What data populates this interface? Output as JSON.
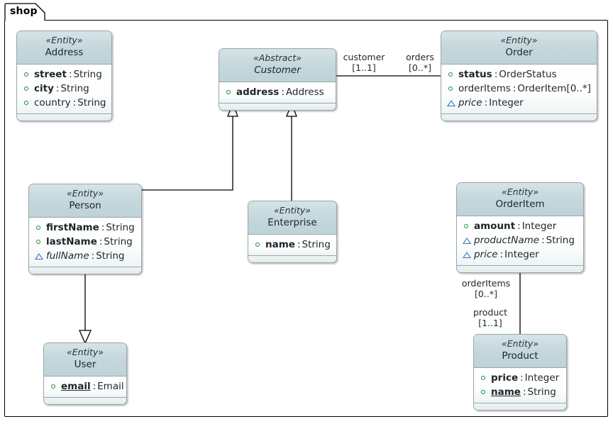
{
  "diagram": {
    "type": "uml-class-diagram",
    "package": {
      "name": "shop"
    },
    "classes": [
      {
        "id": "address",
        "stereotype": "«Entity»",
        "name": "Address",
        "abstract": false,
        "attributes": [
          {
            "icon": "circle",
            "name": "street",
            "sep": ":",
            "type": "String",
            "bold": true,
            "italic": false,
            "underline": false,
            "type_italic": false
          },
          {
            "icon": "circle",
            "name": "city",
            "sep": ":",
            "type": "String",
            "bold": true,
            "italic": false,
            "underline": false,
            "type_italic": false
          },
          {
            "icon": "circle",
            "name": "country",
            "sep": ":",
            "type": "String",
            "bold": false,
            "italic": false,
            "underline": false,
            "type_italic": false
          }
        ]
      },
      {
        "id": "customer",
        "stereotype": "«Abstract»",
        "name": "Customer",
        "abstract": true,
        "attributes": [
          {
            "icon": "circle",
            "name": "address",
            "sep": ":",
            "type": "Address",
            "bold": true,
            "italic": false,
            "underline": false,
            "type_italic": false
          }
        ]
      },
      {
        "id": "order",
        "stereotype": "«Entity»",
        "name": "Order",
        "abstract": false,
        "attributes": [
          {
            "icon": "circle",
            "name": "status",
            "sep": ":",
            "type": "OrderStatus",
            "bold": true,
            "italic": false,
            "underline": false,
            "type_italic": false
          },
          {
            "icon": "circle",
            "name": "orderItems",
            "sep": ":",
            "type": "OrderItem[0..*]",
            "bold": false,
            "italic": false,
            "underline": false,
            "type_italic": false
          },
          {
            "icon": "triangle",
            "name": "price",
            "sep": ":",
            "type": "Integer",
            "bold": false,
            "italic": true,
            "underline": false,
            "type_italic": false
          }
        ]
      },
      {
        "id": "person",
        "stereotype": "«Entity»",
        "name": "Person",
        "abstract": false,
        "attributes": [
          {
            "icon": "circle",
            "name": "firstName",
            "sep": ":",
            "type": "String",
            "bold": true,
            "italic": false,
            "underline": false,
            "type_italic": false
          },
          {
            "icon": "circle",
            "name": "lastName",
            "sep": ":",
            "type": "String",
            "bold": true,
            "italic": false,
            "underline": false,
            "type_italic": false
          },
          {
            "icon": "triangle",
            "name": "fullName",
            "sep": ":",
            "type": "String",
            "bold": false,
            "italic": true,
            "underline": false,
            "type_italic": false
          }
        ]
      },
      {
        "id": "enterprise",
        "stereotype": "«Entity»",
        "name": "Enterprise",
        "abstract": false,
        "attributes": [
          {
            "icon": "circle",
            "name": "name",
            "sep": ":",
            "type": "String",
            "bold": true,
            "italic": false,
            "underline": false,
            "type_italic": false
          }
        ]
      },
      {
        "id": "orderitem",
        "stereotype": "«Entity»",
        "name": "OrderItem",
        "abstract": false,
        "attributes": [
          {
            "icon": "circle",
            "name": "amount",
            "sep": ":",
            "type": "Integer",
            "bold": true,
            "italic": false,
            "underline": false,
            "type_italic": false
          },
          {
            "icon": "triangle",
            "name": "productName",
            "sep": ":",
            "type": "String",
            "bold": false,
            "italic": true,
            "underline": false,
            "type_italic": false
          },
          {
            "icon": "triangle",
            "name": "price",
            "sep": ":",
            "type": "Integer",
            "bold": false,
            "italic": true,
            "underline": false,
            "type_italic": false
          }
        ]
      },
      {
        "id": "user",
        "stereotype": "«Entity»",
        "name": "User",
        "abstract": false,
        "attributes": [
          {
            "icon": "circle",
            "name": "email",
            "sep": ":",
            "type": "Email",
            "bold": true,
            "italic": false,
            "underline": true,
            "type_italic": false
          }
        ]
      },
      {
        "id": "product",
        "stereotype": "«Entity»",
        "name": "Product",
        "abstract": false,
        "attributes": [
          {
            "icon": "circle",
            "name": "price",
            "sep": ":",
            "type": "Integer",
            "bold": true,
            "italic": false,
            "underline": false,
            "type_italic": false
          },
          {
            "icon": "circle",
            "name": "name",
            "sep": ":",
            "type": "String",
            "bold": true,
            "italic": false,
            "underline": true,
            "type_italic": false
          }
        ]
      }
    ],
    "edge_labels": {
      "customer_role": "customer",
      "customer_mult": "[1..1]",
      "orders_role": "orders",
      "orders_mult": "[0..*]",
      "orderitems_role": "orderItems",
      "orderitems_mult": "[0..*]",
      "product_role": "product",
      "product_mult": "[1..1]"
    },
    "relationships": [
      {
        "kind": "association",
        "from": "customer",
        "to": "order"
      },
      {
        "kind": "generalization",
        "from": "person",
        "to": "customer"
      },
      {
        "kind": "generalization",
        "from": "enterprise",
        "to": "customer"
      },
      {
        "kind": "generalization",
        "from": "person",
        "to": "user"
      },
      {
        "kind": "association",
        "from": "orderitem",
        "to": "product"
      }
    ],
    "colors": {
      "header_top": "#d5e3e6",
      "header_bottom": "#bed3d8",
      "border": "#9aa6a9",
      "text": "#1d2529",
      "icon_public": "#178a3c",
      "icon_derived": "#3a72b0",
      "line": "#000000"
    }
  }
}
